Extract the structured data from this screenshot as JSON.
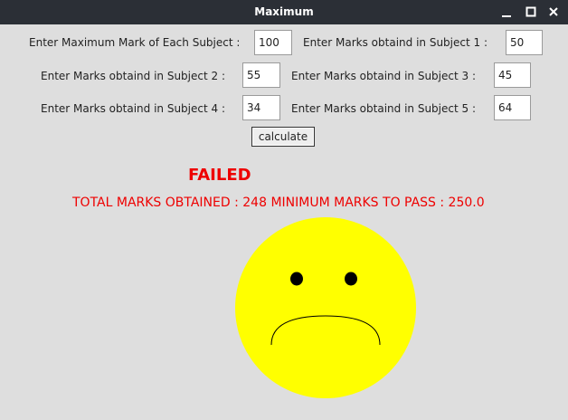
{
  "window": {
    "title": "Maximum",
    "controls": {
      "minimize": "minimize-icon",
      "maximize": "maximize-icon",
      "close": "close-icon"
    }
  },
  "form": {
    "max_mark": {
      "label": "Enter Maximum Mark of Each Subject :",
      "value": "100"
    },
    "subject1": {
      "label": "Enter Marks obtaind in Subject 1 :",
      "value": "50"
    },
    "subject2": {
      "label": "Enter Marks obtaind in Subject 2 :",
      "value": "55"
    },
    "subject3": {
      "label": "Enter Marks obtaind in Subject 3 :",
      "value": "45"
    },
    "subject4": {
      "label": "Enter Marks obtaind in Subject 4 :",
      "value": "34"
    },
    "subject5": {
      "label": "Enter Marks obtaind in Subject 5 :",
      "value": "64"
    },
    "calculate_label": "calculate"
  },
  "result": {
    "status": "FAILED",
    "summary": "TOTAL MARKS OBTAINED : 248  MINIMUM MARKS TO PASS : 250.0"
  },
  "colors": {
    "titlebar": "#2b2f36",
    "background": "#dedede",
    "result_text": "#ee0000",
    "face": "#ffff00"
  },
  "face": {
    "icon": "sad-face-icon",
    "expression": "sad"
  }
}
